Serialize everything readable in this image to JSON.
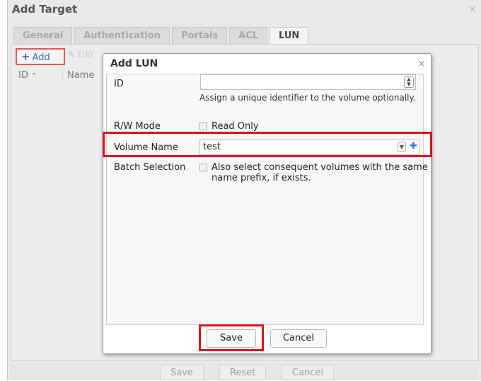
{
  "outer": {
    "title": "Add Target",
    "close": "×",
    "tabs": [
      {
        "label": "General",
        "active": false
      },
      {
        "label": "Authentication",
        "active": false
      },
      {
        "label": "Portals",
        "active": false
      },
      {
        "label": "ACL",
        "active": false
      },
      {
        "label": "LUN",
        "active": true
      }
    ],
    "toolbar": {
      "add_label": "Add",
      "edit_label": "Edit"
    },
    "grid": {
      "columns": [
        "ID",
        "Name"
      ],
      "sort_indicator": "^"
    },
    "buttons": {
      "save": "Save",
      "reset": "Reset",
      "cancel": "Cancel"
    }
  },
  "dialog": {
    "title": "Add LUN",
    "close": "×",
    "id_field": {
      "label": "ID",
      "value": "",
      "hint": "Assign a unique identifier to the volume optionally."
    },
    "rw_mode": {
      "label": "R/W Mode",
      "checkbox_label": "Read Only",
      "checked": false
    },
    "volume_name": {
      "label": "Volume Name",
      "value": "test"
    },
    "batch_selection": {
      "label": "Batch Selection",
      "checkbox_label": "Also select consequent volumes with the same name prefix, if exists.",
      "checked": false
    },
    "buttons": {
      "save": "Save",
      "cancel": "Cancel"
    }
  },
  "colors": {
    "highlight": "#d8141e",
    "add_highlight": "#e05a5a",
    "accent": "#2e74d1"
  },
  "icons": [
    "plus-icon",
    "pencil-icon",
    "close-icon",
    "spinner-icon",
    "dropdown-arrow-icon",
    "add-volume-icon"
  ]
}
